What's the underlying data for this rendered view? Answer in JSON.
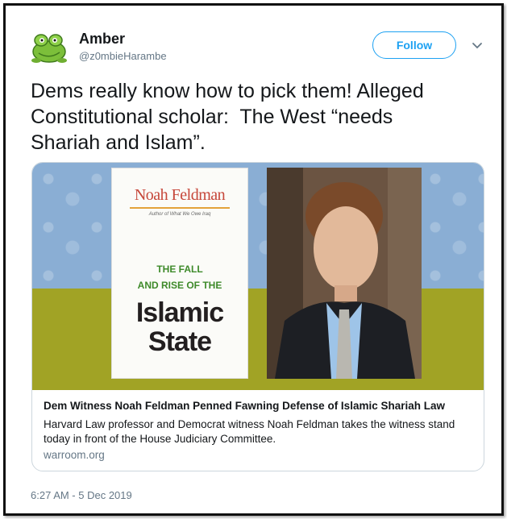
{
  "tweet": {
    "author_name": "Amber",
    "author_handle": "@z0mbieHarambe",
    "follow_label": "Follow",
    "text": "Dems really know how to pick them! Alleged\nConstitutional scholar:  The West “needs\nShariah and Islam”.",
    "timestamp": "6:27 AM - 5 Dec 2019"
  },
  "card": {
    "title": "Dem Witness Noah Feldman Penned Fawning Defense of Islamic Shariah Law",
    "description": "Harvard Law professor and Democrat witness Noah Feldman takes the witness stand today in front of the House Judiciary Committee.",
    "domain": "warroom.org",
    "book": {
      "author": "Noah Feldman",
      "subtitle": "Author of What We Owe Iraq",
      "line1": "THE FALL",
      "line2": "AND RISE OF THE",
      "line3": "Islamic",
      "line4": "State"
    }
  },
  "icons": {
    "avatar": "frog-avatar-icon",
    "caret": "chevron-down-icon"
  },
  "colors": {
    "accent": "#1da1f2",
    "secondary_text": "#657786",
    "banner_blue": "#8aaed4",
    "banner_olive": "#a1a325",
    "book_green": "#3e8a2a",
    "book_red": "#c6473a"
  }
}
